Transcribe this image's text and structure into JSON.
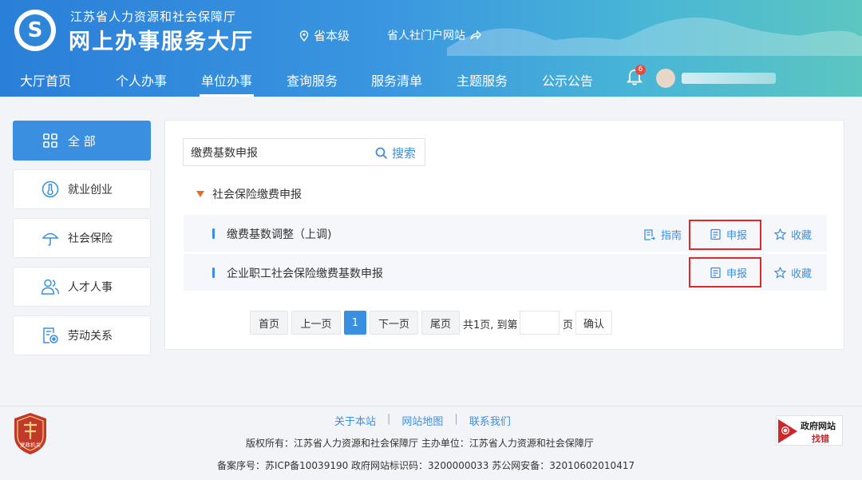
{
  "header": {
    "subtitle": "江苏省人力资源和社会保障厅",
    "title": "网上办事服务大厅",
    "location": "省本级",
    "portal_link": "省人社门户网站",
    "notification_count": "6"
  },
  "nav": {
    "items": [
      "大厅首页",
      "个人办事",
      "单位办事",
      "查询服务",
      "服务清单",
      "主题服务",
      "公示公告"
    ],
    "active": "单位办事"
  },
  "sidebar": {
    "items": [
      {
        "label": "全 部",
        "icon": "grid-icon",
        "active": true
      },
      {
        "label": "就业创业",
        "icon": "thermometer-icon",
        "active": false
      },
      {
        "label": "社会保险",
        "icon": "umbrella-icon",
        "active": false
      },
      {
        "label": "人才人事",
        "icon": "people-icon",
        "active": false
      },
      {
        "label": "劳动关系",
        "icon": "document-gear-icon",
        "active": false
      }
    ]
  },
  "search": {
    "value": "缴费基数申报",
    "button_label": "搜索"
  },
  "category": {
    "label": "社会保险缴费申报"
  },
  "results": [
    {
      "title": "缴费基数调整（上调)",
      "guide_label": "指南",
      "apply_label": "申报",
      "favorite_label": "收藏"
    },
    {
      "title": "企业职工社会保险缴费基数申报",
      "apply_label": "申报",
      "favorite_label": "收藏"
    }
  ],
  "pagination": {
    "first": "首页",
    "prev": "上一页",
    "current": "1",
    "next": "下一页",
    "last": "尾页",
    "summary": "共1页, 到第",
    "page_unit": "页",
    "confirm": "确认"
  },
  "footer": {
    "links": [
      "关于本站",
      "网站地图",
      "联系我们"
    ],
    "copyright": "版权所有：江苏省人力资源和社会保障厅    主办单位：江苏省人力资源和社会保障厅",
    "record": "备案序号：苏ICP备10039190    政府网站标识码：3200000033    苏公网安备：32010602010417",
    "emblem_text": "党政机关",
    "error_badge_line1": "政府网站",
    "error_badge_line2": "找错"
  },
  "colors": {
    "accent": "#3b8fe0",
    "highlight_border": "#e0282a",
    "triangle": "#e46d2a"
  }
}
